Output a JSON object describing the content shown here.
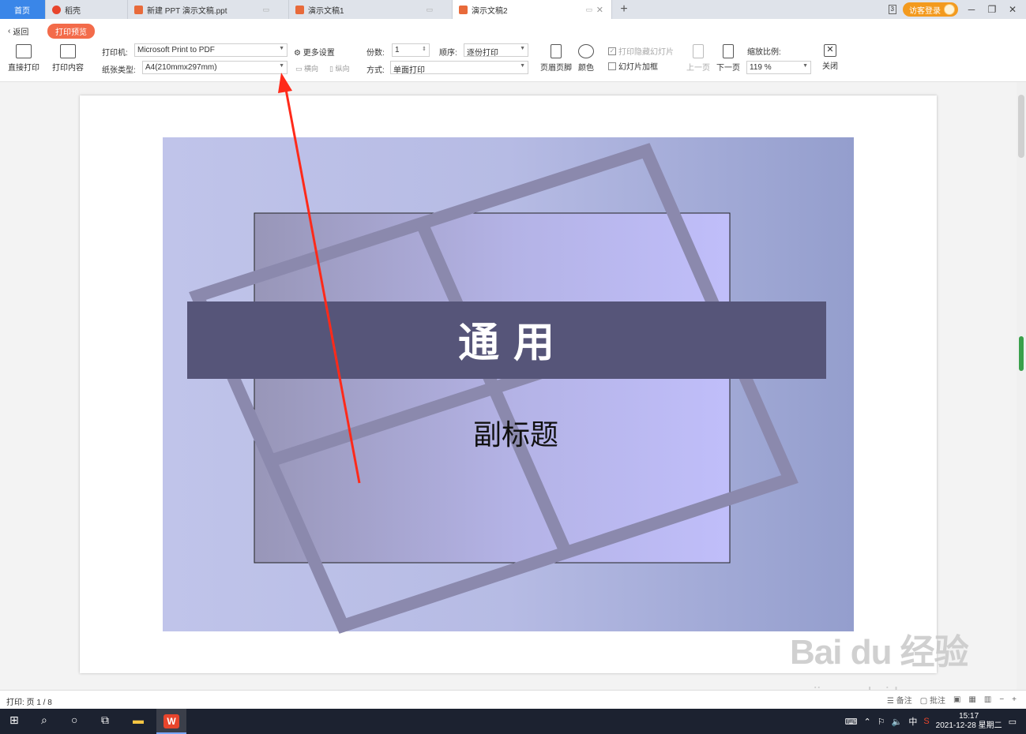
{
  "tabs": [
    {
      "label": "首页"
    },
    {
      "label": "稻壳"
    },
    {
      "label": "新建 PPT 演示文稿.ppt"
    },
    {
      "label": "演示文稿1"
    },
    {
      "label": "演示文稿2"
    }
  ],
  "topbar": {
    "badge": "3",
    "login": "访客登录"
  },
  "toolbar": {
    "back": "返回",
    "mode": "打印预览",
    "direct_print": "直接打印",
    "print_content": "打印内容",
    "printer_label": "打印机:",
    "printer_value": "Microsoft Print to PDF",
    "paper_label": "纸张类型:",
    "paper_value": "A4(210mmx297mm)",
    "more_settings": "更多设置",
    "landscape": "横向",
    "portrait": "纵向",
    "copies_label": "份数:",
    "copies_value": "1",
    "order_label": "顺序:",
    "order_value": "逐份打印",
    "method_label": "方式:",
    "method_value": "单面打印",
    "header_footer": "页眉页脚",
    "color": "颜色",
    "print_hidden": "打印隐藏幻灯片",
    "slide_frame": "幻灯片加框",
    "prev_page": "上一页",
    "next_page": "下一页",
    "zoom_label": "缩放比例:",
    "zoom_value": "119 %",
    "close": "关闭"
  },
  "slide": {
    "title": "通  用",
    "subtitle": "副标题"
  },
  "status": {
    "page_info": "打印: 页 1 / 8",
    "notes": "备注",
    "comments": "批注"
  },
  "taskbar": {
    "time": "15:17",
    "date": "2021-12-28 星期二",
    "ime": "中"
  },
  "watermark": {
    "brand": "Bai du 经验",
    "url": "jingyan.baidu.com"
  },
  "colors": {
    "accent_blue": "#3a86e8",
    "pill_orange": "#f36b4a",
    "login_orange": "#f39a1e",
    "title_band": "#565579",
    "frame": "#8b89ad",
    "arrow_red": "#ff2a1a"
  }
}
